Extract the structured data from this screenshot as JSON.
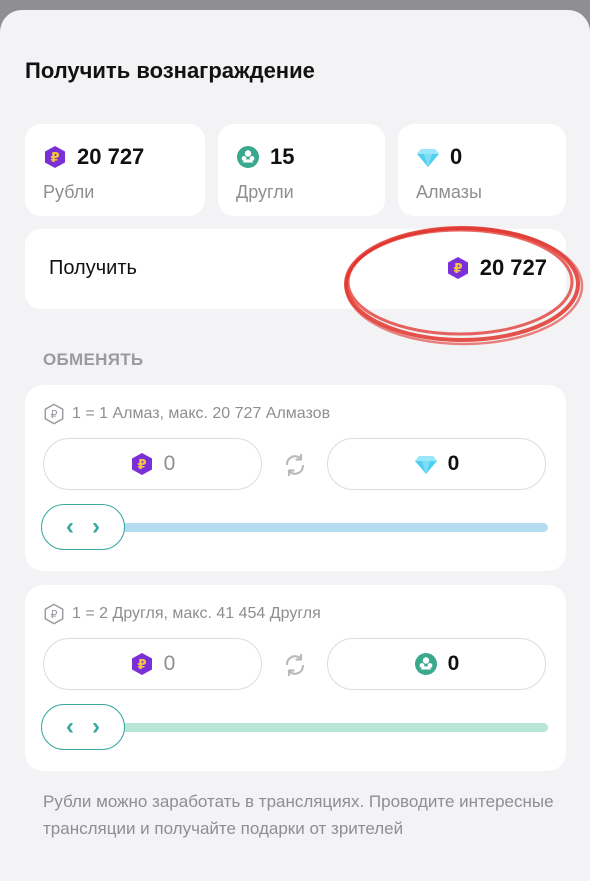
{
  "sheet": {
    "title": "Получить вознаграждение"
  },
  "balances": [
    {
      "icon": "ruble-coin-icon",
      "value": "20 727",
      "label": "Рубли"
    },
    {
      "icon": "friend-icon",
      "value": "15",
      "label": "Другли"
    },
    {
      "icon": "diamond-icon",
      "value": "0",
      "label": "Алмазы"
    }
  ],
  "receive": {
    "label": "Получить",
    "value": "20 727"
  },
  "exchange": {
    "heading": "ОБМЕНЯТЬ",
    "diamonds": {
      "rate": "1 = 1 Алмаз, макс. 20 727 Алмазов",
      "from_value": "0",
      "to_value": "0",
      "slider_level": 0
    },
    "friends": {
      "rate": "1 = 2 Другля, макс. 41 454 Другля",
      "from_value": "0",
      "to_value": "0",
      "slider_level": 0
    }
  },
  "footer": {
    "note": "Рубли можно заработать в трансляциях. Проводите интересные трансляции и получайте подарки от зрителей"
  },
  "colors": {
    "ruble_purple": "#7b2fd6",
    "friend_green": "#3aa88c",
    "diamond_cyan": "#4fd0f0",
    "diamond_track": "#b4dcf0",
    "friend_track": "#b8e6d6",
    "handle_border": "#3aa8a0",
    "highlight_red": "#e0332b"
  }
}
